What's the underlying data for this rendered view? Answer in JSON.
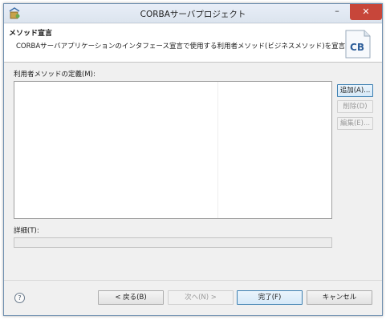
{
  "window": {
    "title": "CORBAサーバプロジェクト",
    "minimize_glyph": "–",
    "close_glyph": "✕"
  },
  "banner": {
    "title": "メソッド宣言",
    "description": "CORBAサーバアプリケーションのインタフェース宣言で使用する利用者メソッド(ビジネスメソッド)を宣言します。",
    "logo_text": "CB"
  },
  "methods": {
    "label": "利用者メソッドの定義(M):",
    "rows": []
  },
  "side_buttons": {
    "add": "追加(A)...",
    "remove": "削除(D)",
    "edit": "編集(E)..."
  },
  "details": {
    "label": "詳細(T):",
    "value": ""
  },
  "footer": {
    "help": "?",
    "back": "< 戻る(B)",
    "next": "次へ(N) >",
    "finish": "完了(F)",
    "cancel": "キャンセル"
  },
  "colors": {
    "close_button": "#c7463a",
    "logo_blue": "#2f5f9a"
  }
}
